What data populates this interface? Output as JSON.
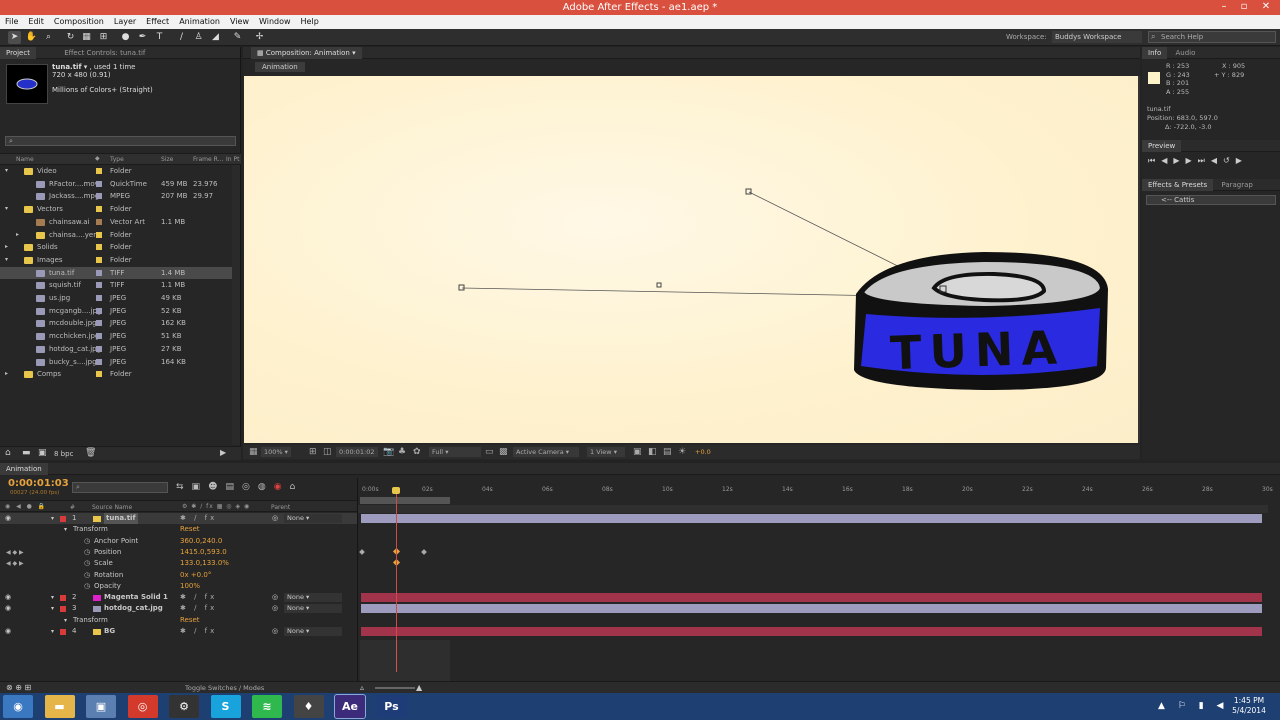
{
  "window": {
    "title": "Adobe After Effects - ae1.aep *"
  },
  "menu": [
    "File",
    "Edit",
    "Composition",
    "Layer",
    "Effect",
    "Animation",
    "View",
    "Window",
    "Help"
  ],
  "workspace": {
    "label": "Workspace:",
    "value": "Buddys Workspace",
    "search_placeholder": "Search Help"
  },
  "project_panel": {
    "tabs": [
      "Project",
      "Effect Controls: tuna.tif"
    ],
    "selected_name": "tuna.tif",
    "used": ", used 1 time",
    "dims": "720 x 480 (0.91)",
    "colors": "Millions of Colors+ (Straight)",
    "columns": {
      "name": "Name",
      "type": "Type",
      "size": "Size",
      "frame_rate": "Frame R...",
      "in_point": "In Pt"
    },
    "items": [
      {
        "name": "Video",
        "type": "Folder",
        "size": "",
        "fr": "",
        "indent": 0,
        "kind": "folder-open",
        "color": "#e8c54b"
      },
      {
        "name": "RFactor....mov",
        "type": "QuickTime",
        "size": "459 MB",
        "fr": "23.976",
        "indent": 1,
        "kind": "file",
        "color": "#9a9ab8"
      },
      {
        "name": "Jackass....mpg",
        "type": "MPEG",
        "size": "207 MB",
        "fr": "29.97",
        "indent": 1,
        "kind": "file",
        "color": "#9a9ab8"
      },
      {
        "name": "Vectors",
        "type": "Folder",
        "size": "",
        "fr": "",
        "indent": 0,
        "kind": "folder-open",
        "color": "#e8c54b"
      },
      {
        "name": "chainsaw.ai",
        "type": "Vector Art",
        "size": "1.1 MB",
        "fr": "",
        "indent": 1,
        "kind": "file",
        "color": "#a57c52"
      },
      {
        "name": "chainsa....yers",
        "type": "Folder",
        "size": "",
        "fr": "",
        "indent": 1,
        "kind": "folder",
        "color": "#e8c54b"
      },
      {
        "name": "Solids",
        "type": "Folder",
        "size": "",
        "fr": "",
        "indent": 0,
        "kind": "folder",
        "color": "#e8c54b"
      },
      {
        "name": "Images",
        "type": "Folder",
        "size": "",
        "fr": "",
        "indent": 0,
        "kind": "folder-open",
        "color": "#e8c54b"
      },
      {
        "name": "tuna.tif",
        "type": "TIFF",
        "size": "1.4 MB",
        "fr": "",
        "indent": 1,
        "kind": "file",
        "color": "#9a9ab8",
        "selected": true
      },
      {
        "name": "squish.tif",
        "type": "TIFF",
        "size": "1.1 MB",
        "fr": "",
        "indent": 1,
        "kind": "file",
        "color": "#9a9ab8"
      },
      {
        "name": "us.jpg",
        "type": "JPEG",
        "size": "49 KB",
        "fr": "",
        "indent": 1,
        "kind": "file",
        "color": "#9a9ab8"
      },
      {
        "name": "mcgangb....jpg",
        "type": "JPEG",
        "size": "52 KB",
        "fr": "",
        "indent": 1,
        "kind": "file",
        "color": "#9a9ab8"
      },
      {
        "name": "mcdouble.jpg",
        "type": "JPEG",
        "size": "162 KB",
        "fr": "",
        "indent": 1,
        "kind": "file",
        "color": "#9a9ab8"
      },
      {
        "name": "mcchicken.jpg",
        "type": "JPEG",
        "size": "51 KB",
        "fr": "",
        "indent": 1,
        "kind": "file",
        "color": "#9a9ab8"
      },
      {
        "name": "hotdog_cat.jpg",
        "type": "JPEG",
        "size": "27 KB",
        "fr": "",
        "indent": 1,
        "kind": "file",
        "color": "#9a9ab8"
      },
      {
        "name": "bucky_s....jpg",
        "type": "JPEG",
        "size": "164 KB",
        "fr": "",
        "indent": 1,
        "kind": "file",
        "color": "#9a9ab8"
      },
      {
        "name": "Comps",
        "type": "Folder",
        "size": "",
        "fr": "",
        "indent": 0,
        "kind": "folder",
        "color": "#e8c54b"
      }
    ],
    "bpc": "8 bpc"
  },
  "composition": {
    "tab": "Composition: Animation",
    "subtab": "Animation",
    "zoom": "100%",
    "timecode": "0:00:01:02",
    "resolution": "Full",
    "camera": "Active Camera",
    "views": "1 View",
    "exposure": "+0.0",
    "tuna_label": "TUNA"
  },
  "info_panel": {
    "tabs": [
      "Info",
      "Audio"
    ],
    "r": "R : 253",
    "g": "G : 243",
    "b": "B : 201",
    "a": "A : 255",
    "x": "X : 905",
    "y": "+ Y : 829",
    "layer": "tuna.tif",
    "position": "Position: 683.0, 597.0",
    "delta": "Δ: -722.0, -3.0"
  },
  "preview_panel": {
    "title": "Preview"
  },
  "effects_panel": {
    "tabs": [
      "Effects & Presets",
      "Paragrap"
    ],
    "search": "<-- Cattis"
  },
  "timeline": {
    "tab": "Animation",
    "timecode": "0:00:01:03",
    "frames": "00027 (24.00 fps)",
    "headers": {
      "source": "Source Name",
      "parent": "Parent"
    },
    "ruler": [
      "0:00s",
      "02s",
      "04s",
      "06s",
      "08s",
      "10s",
      "12s",
      "14s",
      "16s",
      "18s",
      "20s",
      "22s",
      "24s",
      "26s",
      "28s",
      "30s"
    ],
    "layers": [
      {
        "num": "1",
        "name": "tuna.tif",
        "parent": "None",
        "label_color": "#e8c54b",
        "bar_color": "#9d9cbe",
        "selected": true
      },
      {
        "prop": "Transform",
        "value": "Reset"
      },
      {
        "prop": "Anchor Point",
        "value": "360.0,240.0"
      },
      {
        "prop": "Position",
        "value": "1415.0,593.0"
      },
      {
        "prop": "Scale",
        "value": "133.0,133.0%"
      },
      {
        "prop": "Rotation",
        "value": "0x +0.0°"
      },
      {
        "prop": "Opacity",
        "value": "100%"
      },
      {
        "num": "2",
        "name": "Magenta Solid 1",
        "parent": "None",
        "label_color": "#e020c8",
        "bar_color": "#a1334a"
      },
      {
        "num": "3",
        "name": "hotdog_cat.jpg",
        "parent": "None",
        "label_color": "#9a9ab8",
        "bar_color": "#9d9cbe"
      },
      {
        "prop": "Transform",
        "value": "Reset"
      },
      {
        "num": "4",
        "name": "BG",
        "parent": "None",
        "label_color": "#e8c54b",
        "bar_color": "#a1334a"
      }
    ],
    "footer": "Toggle Switches / Modes"
  },
  "taskbar": {
    "time": "1:45 PM",
    "date": "5/4/2014",
    "apps": [
      {
        "label": "◉",
        "color": "#3b78c2"
      },
      {
        "label": "▬",
        "color": "#e6b54a"
      },
      {
        "label": "▣",
        "color": "#5a7fb0"
      },
      {
        "label": "◎",
        "color": "#d33a2c"
      },
      {
        "label": "⚙",
        "color": "#333"
      },
      {
        "label": "S",
        "color": "#19a3dc"
      },
      {
        "label": "≋",
        "color": "#2fb84d"
      },
      {
        "label": "♦",
        "color": "#444"
      },
      {
        "label": "Ae",
        "color": "#3c2a7a"
      },
      {
        "label": "Ps",
        "color": "#1d3c78"
      }
    ]
  }
}
